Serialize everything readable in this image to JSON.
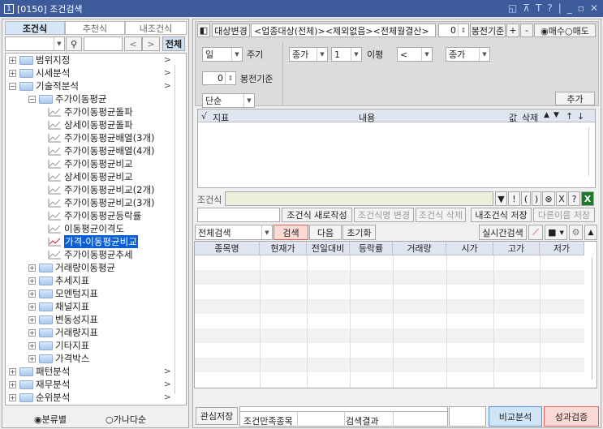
{
  "window": {
    "number": "1",
    "title": "[0150]  조건검색",
    "controls": [
      "◱",
      "⊼",
      "T",
      "?",
      "|",
      "_",
      "▫",
      "✕"
    ]
  },
  "left": {
    "tabs": [
      {
        "label": "조건식",
        "active": true
      },
      {
        "label": "추천식",
        "active": false
      },
      {
        "label": "내조건식",
        "active": false
      }
    ],
    "search_value": "",
    "nav_prev": "<",
    "nav_next": ">",
    "all_button": "전체",
    "tree": [
      {
        "label": "범위지정",
        "level": 0,
        "type": "folder",
        "expander": "+",
        "arrow": ">"
      },
      {
        "label": "시세분석",
        "level": 0,
        "type": "folder",
        "expander": "+",
        "arrow": ">"
      },
      {
        "label": "기술적분석",
        "level": 0,
        "type": "folder",
        "expander": "-",
        "arrow": ">"
      },
      {
        "label": "주가이동평균",
        "level": 1,
        "type": "folder",
        "expander": "-"
      },
      {
        "label": "주가이동평균돌파",
        "level": 2,
        "type": "leaf"
      },
      {
        "label": "상세이동평균돌파",
        "level": 2,
        "type": "leaf"
      },
      {
        "label": "주가이동평균배열(3개)",
        "level": 2,
        "type": "leaf"
      },
      {
        "label": "주가이동평균배열(4개)",
        "level": 2,
        "type": "leaf"
      },
      {
        "label": "주가이동평균비교",
        "level": 2,
        "type": "leaf"
      },
      {
        "label": "상세이동평균비교",
        "level": 2,
        "type": "leaf"
      },
      {
        "label": "주가이동평균비교(2개)",
        "level": 2,
        "type": "leaf"
      },
      {
        "label": "주가이동평균비교(3개)",
        "level": 2,
        "type": "leaf"
      },
      {
        "label": "주가이동평균등락률",
        "level": 2,
        "type": "leaf"
      },
      {
        "label": "이동평균이격도",
        "level": 2,
        "type": "leaf"
      },
      {
        "label": "가격-이동평균비교",
        "level": 2,
        "type": "leaf",
        "selected": true
      },
      {
        "label": "주가이동평균추세",
        "level": 2,
        "type": "leaf"
      },
      {
        "label": "거래량이동평균",
        "level": 1,
        "type": "folder",
        "expander": "+"
      },
      {
        "label": "추세지표",
        "level": 1,
        "type": "folder",
        "expander": "+"
      },
      {
        "label": "모멘텀지표",
        "level": 1,
        "type": "folder",
        "expander": "+"
      },
      {
        "label": "채널지표",
        "level": 1,
        "type": "folder",
        "expander": "+"
      },
      {
        "label": "변동성지표",
        "level": 1,
        "type": "folder",
        "expander": "+"
      },
      {
        "label": "거래량지표",
        "level": 1,
        "type": "folder",
        "expander": "+"
      },
      {
        "label": "기타지표",
        "level": 1,
        "type": "folder",
        "expander": "+"
      },
      {
        "label": "가격박스",
        "level": 1,
        "type": "folder",
        "expander": "+"
      },
      {
        "label": "패턴분석",
        "level": 0,
        "type": "folder",
        "expander": "+",
        "arrow": ">"
      },
      {
        "label": "재무분석",
        "level": 0,
        "type": "folder",
        "expander": "+",
        "arrow": ">"
      },
      {
        "label": "순위분석",
        "level": 0,
        "type": "folder",
        "expander": "+",
        "arrow": ">"
      }
    ],
    "sort_options": [
      {
        "label": "분류별",
        "checked": true
      },
      {
        "label": "가나다순",
        "checked": false
      }
    ]
  },
  "right": {
    "target_change": "대상변경",
    "target_text": "<업종대상(전체)><제외없음><전체월결산>",
    "bong_value": "0",
    "bong_label": "봉전기준",
    "plus": "+",
    "minus": "-",
    "trade": [
      {
        "label": "매수",
        "checked": true
      },
      {
        "label": "매도",
        "checked": false
      }
    ],
    "period": "일",
    "period_label": "주기",
    "bong2_value": "0",
    "bong2_label": "봉전기준",
    "type": "단순",
    "cond": {
      "field1": "종가",
      "n": "1",
      "label": "이평",
      "op": "<",
      "field2": "종가"
    },
    "add_button": "추가",
    "indicator_headers": [
      "√",
      "지표",
      "내용",
      "값",
      "삭제",
      "▲",
      "▼",
      "↑",
      "↓"
    ],
    "formula_label": "조건식",
    "formula_value": "",
    "formula_buttons": [
      "▼",
      "!",
      "(",
      ")",
      "⊗",
      "X",
      "?"
    ],
    "name_value": "",
    "actions": [
      {
        "label": "조건식 새로작성",
        "enabled": true
      },
      {
        "label": "조건식명 변경",
        "enabled": false
      },
      {
        "label": "조건식 삭제",
        "enabled": false
      },
      {
        "label": "내조건식 저장",
        "enabled": true
      },
      {
        "label": "다른이름 저장",
        "enabled": false
      }
    ],
    "search_scope": "전체검색",
    "search": "검색",
    "next": "다음",
    "reset": "초기화",
    "realtime": "실시간검색",
    "result_headers": [
      "종목명",
      "현재가",
      "전일대비",
      "등락률",
      "거래량",
      "시가",
      "고가",
      "저가"
    ],
    "save_interest": "관심저장",
    "status_label": "조건만족종목",
    "status_value": "",
    "result_label": "검색결과",
    "result_value": "",
    "extra_value": "",
    "compare": "비교분석",
    "performance": "성과검증",
    "colors": {
      "compare_bg": "#cfe5f7",
      "compare_border": "#5b8fd6",
      "perf_bg": "#fbd9d5",
      "perf_border": "#e06060",
      "search_bg": "#fbd9d5"
    }
  }
}
